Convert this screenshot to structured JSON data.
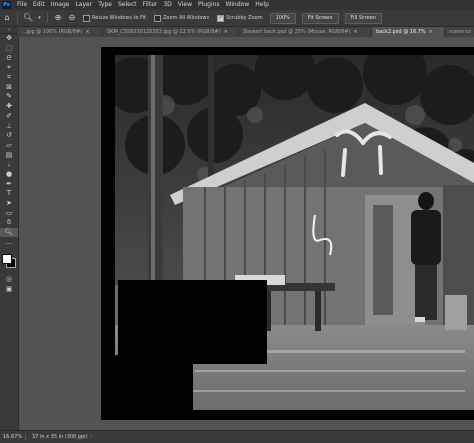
{
  "app": {
    "logo_text": "Ps"
  },
  "menubar": {
    "items": [
      "File",
      "Edit",
      "Image",
      "Layer",
      "Type",
      "Select",
      "Filter",
      "3D",
      "View",
      "Plugins",
      "Window",
      "Help"
    ]
  },
  "options": {
    "resize_windows_label": "Resize Windows to Fit",
    "resize_windows_checked": false,
    "zoom_all_label": "Zoom All Windows",
    "zoom_all_checked": false,
    "scrubby_label": "Scrubby Zoom",
    "scrubby_checked": true,
    "zoom_value": "100%",
    "fit_screen_label": "Fit Screen",
    "fill_screen_label": "Fill Screen"
  },
  "tabs": [
    {
      "label": "...jpg @ 100% (RGB/8#)",
      "active": false
    },
    {
      "label": "SKM_C558230125353.jpg @ 12.5% (RGB/8#)",
      "active": false
    },
    {
      "label": "Stewart back.psd @ 25% (Mouse, RGB/8#)",
      "active": false
    },
    {
      "label": "back2.psd @ 16.7%",
      "active": true
    },
    {
      "label": "scene co",
      "active": false
    }
  ],
  "tools": [
    "move-icon",
    "marquee-icon",
    "lasso-icon",
    "object-select-icon",
    "crop-icon",
    "frame-icon",
    "eyedropper-icon",
    "healing-icon",
    "brush-icon",
    "stamp-icon",
    "history-brush-icon",
    "eraser-icon",
    "gradient-icon",
    "blur-icon",
    "dodge-icon",
    "pen-icon",
    "type-icon",
    "path-select-icon",
    "rectangle-icon",
    "hand-icon",
    "zoom-icon",
    "more-tools-icon"
  ],
  "colors": {
    "foreground": "#ffffff",
    "background": "#000000"
  },
  "status": {
    "zoom": "16.67%",
    "doc_info": "37 in x 35 in (300 ppi)"
  }
}
